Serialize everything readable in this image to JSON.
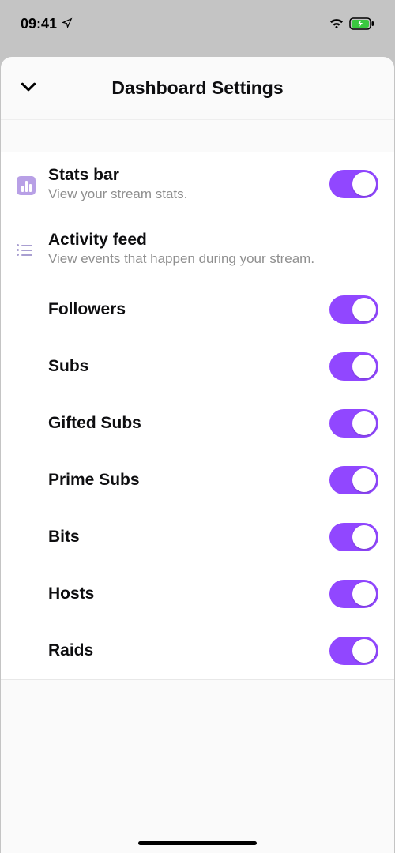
{
  "status": {
    "time": "09:41"
  },
  "header": {
    "title": "Dashboard Settings"
  },
  "sections": {
    "stats": {
      "title": "Stats bar",
      "subtitle": "View your stream stats.",
      "enabled": true
    },
    "activity": {
      "title": "Activity feed",
      "subtitle": "View events that happen during your stream."
    }
  },
  "activityItems": [
    {
      "label": "Followers",
      "enabled": true
    },
    {
      "label": "Subs",
      "enabled": true
    },
    {
      "label": "Gifted Subs",
      "enabled": true
    },
    {
      "label": "Prime Subs",
      "enabled": true
    },
    {
      "label": "Bits",
      "enabled": true
    },
    {
      "label": "Hosts",
      "enabled": true
    },
    {
      "label": "Raids",
      "enabled": true
    }
  ]
}
